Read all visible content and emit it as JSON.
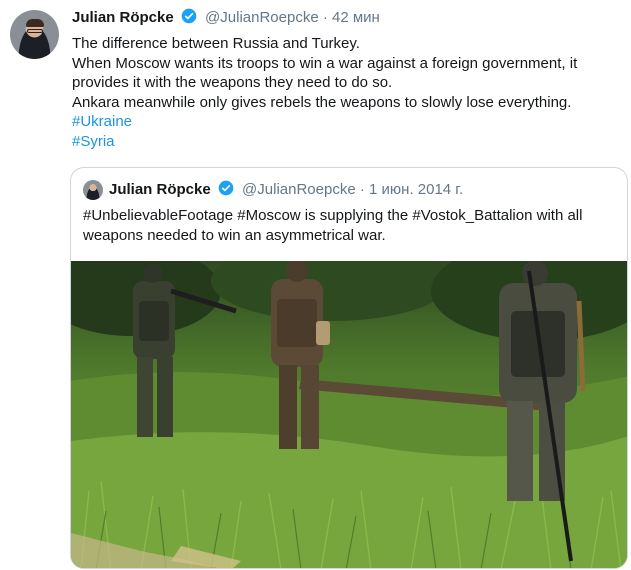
{
  "tweet": {
    "author_name": "Julian Röpcke",
    "handle": "@JulianRoepcke",
    "separator": "·",
    "time": "42 мин",
    "lines": [
      "The difference between Russia and Turkey.",
      "When Moscow wants its troops to win a war against a foreign government, it",
      "provides it with the weapons they need to do so.",
      "Ankara meanwhile only gives rebels the weapons to slowly lose everything."
    ],
    "hashtags": [
      "#Ukraine",
      "#Syria"
    ]
  },
  "quoted": {
    "author_name": "Julian Röpcke",
    "handle": "@JulianRoepcke",
    "separator": "·",
    "date": "1 июн. 2014 г.",
    "lines": [
      "#UnbelievableFootage #Moscow is supplying the #Vostok_Battalion with all",
      "weapons needed to win an asymmetrical war."
    ]
  },
  "colors": {
    "link": "#1b95e0",
    "verified": "#1da1f2",
    "secondary_text": "#657786",
    "border": "#ccd6dd"
  }
}
